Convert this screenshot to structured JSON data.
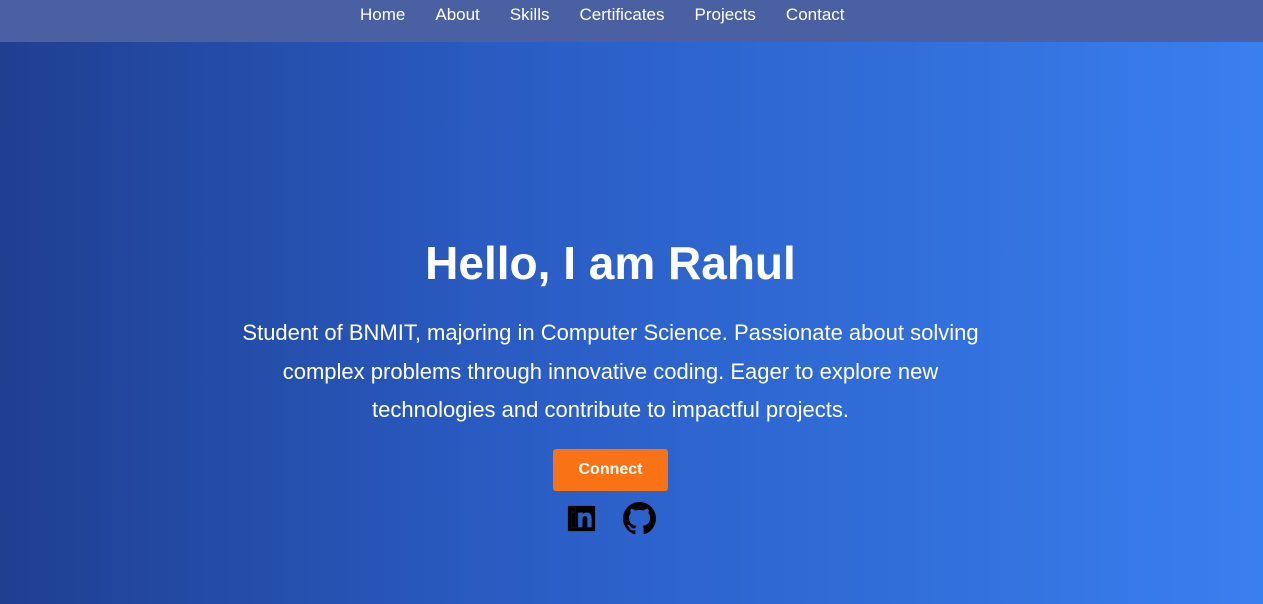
{
  "nav": {
    "items": [
      {
        "label": "Home"
      },
      {
        "label": "About"
      },
      {
        "label": "Skills"
      },
      {
        "label": "Certificates"
      },
      {
        "label": "Projects"
      },
      {
        "label": "Contact"
      }
    ]
  },
  "hero": {
    "title": "Hello, I am Rahul",
    "bio": "Student of BNMIT, majoring in Computer Science. Passionate about solving complex problems through innovative coding. Eager to explore new technologies and contribute to impactful projects.",
    "connect_label": "Connect"
  },
  "social": {
    "icons": [
      "linkedin-icon",
      "github-icon"
    ]
  },
  "colors": {
    "navbar": "#4b5fa3",
    "gradient_start": "#1f3f91",
    "gradient_end": "#3a7ff0",
    "button": "#f97316",
    "text": "#ffffff"
  }
}
